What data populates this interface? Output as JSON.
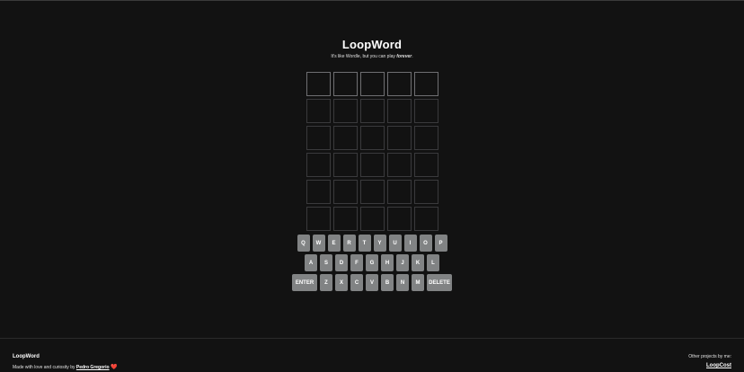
{
  "header": {
    "title": "LoopWord",
    "subtitle_prefix": "It's like Wordle, but you can play ",
    "subtitle_emphasis": "forever",
    "subtitle_suffix": "."
  },
  "board": {
    "rows": 6,
    "columns": 5,
    "active_row": 0
  },
  "keyboard": {
    "row1": [
      "Q",
      "W",
      "E",
      "R",
      "T",
      "Y",
      "U",
      "I",
      "O",
      "P"
    ],
    "row2": [
      "A",
      "S",
      "D",
      "F",
      "G",
      "H",
      "J",
      "K",
      "L"
    ],
    "row3": [
      "ENTER",
      "Z",
      "X",
      "C",
      "V",
      "B",
      "N",
      "M",
      "DELETE"
    ]
  },
  "footer": {
    "brand": "LoopWord",
    "credit_prefix": "Made with love and curiosity by ",
    "author": "Pedro Gregorio",
    "heart": "❤️",
    "other_label": "Other projects by me:",
    "other_link": "LoopCost"
  },
  "colors": {
    "background": "#121212",
    "tile_border": "#3a3a3c",
    "active_tile_border": "#6f6f72",
    "key": "#818384",
    "heart": "#e0245e"
  }
}
